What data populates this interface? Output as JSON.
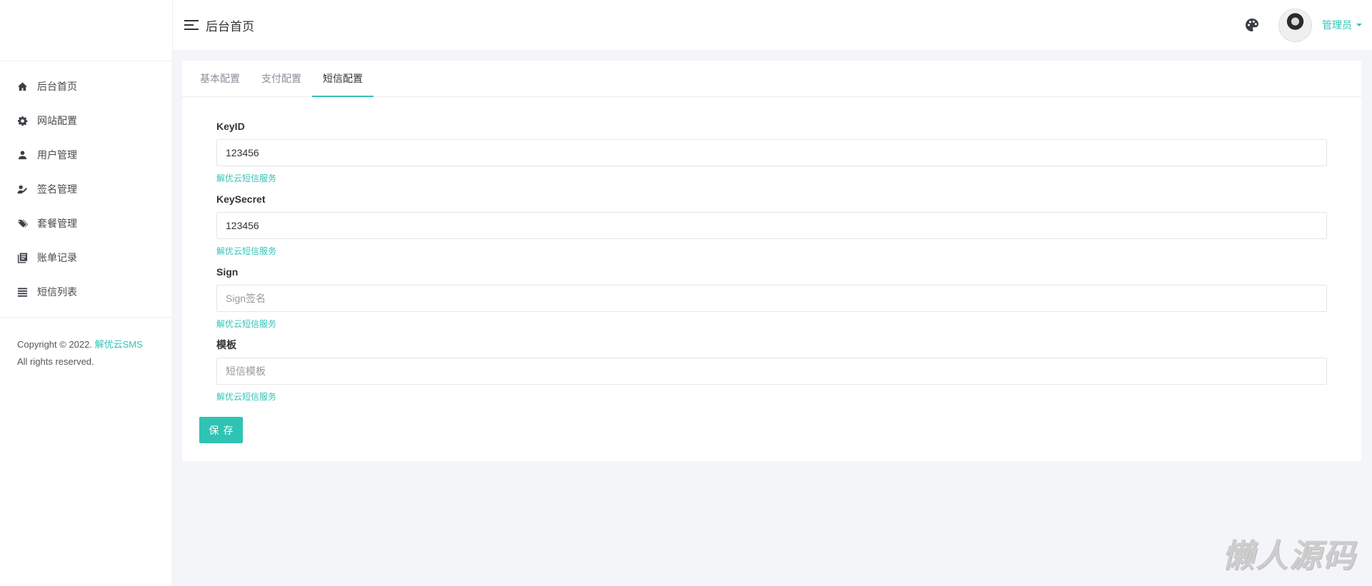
{
  "sidebar": {
    "items": [
      {
        "label": "后台首页",
        "icon": "home-icon"
      },
      {
        "label": "网站配置",
        "icon": "gear-icon"
      },
      {
        "label": "用户管理",
        "icon": "user-icon"
      },
      {
        "label": "签名管理",
        "icon": "signature-icon"
      },
      {
        "label": "套餐管理",
        "icon": "tags-icon"
      },
      {
        "label": "账单记录",
        "icon": "book-icon"
      },
      {
        "label": "短信列表",
        "icon": "list-icon"
      }
    ],
    "copyright_prefix": "Copyright © 2022.",
    "copyright_link": "解优云SMS",
    "rights": "All rights reserved."
  },
  "header": {
    "title": "后台首页",
    "user_name": "管理员"
  },
  "tabs": [
    {
      "label": "基本配置",
      "active": false
    },
    {
      "label": "支付配置",
      "active": false
    },
    {
      "label": "短信配置",
      "active": true
    }
  ],
  "form": {
    "fields": [
      {
        "label": "KeyID",
        "value": "123456",
        "placeholder": "",
        "help": "解优云短信服务"
      },
      {
        "label": "KeySecret",
        "value": "123456",
        "placeholder": "",
        "help": "解优云短信服务"
      },
      {
        "label": "Sign",
        "value": "",
        "placeholder": "Sign签名",
        "help": "解优云短信服务"
      },
      {
        "label": "模板",
        "value": "",
        "placeholder": "短信模板",
        "help": "解优云短信服务"
      }
    ],
    "save_label": "保存"
  },
  "watermark": "懒人源码",
  "colors": {
    "accent": "#33c3b6",
    "button": "#2fc3b4",
    "background": "#f4f5f9"
  }
}
